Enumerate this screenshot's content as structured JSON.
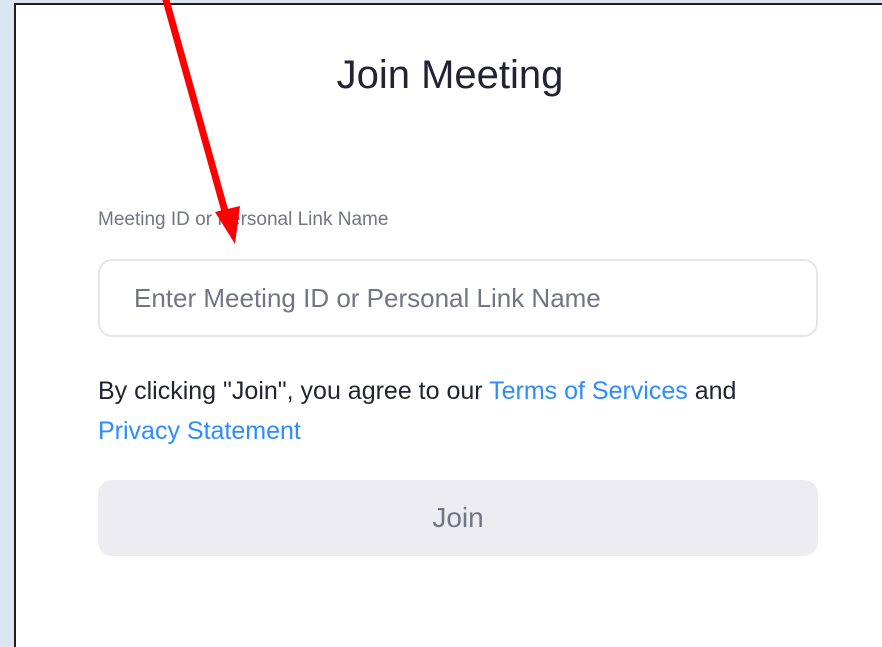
{
  "dialog": {
    "title": "Join Meeting",
    "field_label": "Meeting ID or Personal Link Name",
    "input": {
      "value": "",
      "placeholder": "Enter Meeting ID or Personal Link Name"
    },
    "agreement": {
      "prefix": "By clicking \"Join\", you agree to our ",
      "terms_link": "Terms of Services",
      "conjunction": " and",
      "privacy_link": "Privacy Statement"
    },
    "join_button_label": "Join"
  },
  "annotation": {
    "type": "arrow",
    "color": "#ff0000"
  },
  "colors": {
    "link": "#2d8cff",
    "button_disabled_bg": "#ececf1",
    "text_primary": "#232333",
    "text_secondary": "#747487"
  }
}
